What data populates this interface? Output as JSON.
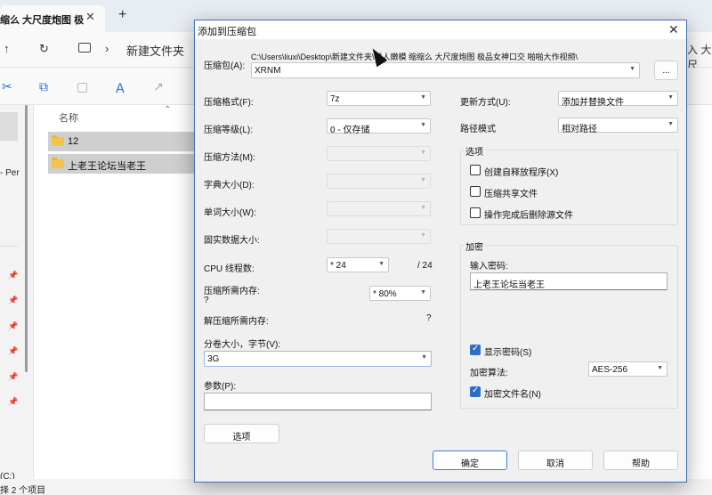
{
  "explorer": {
    "tab_title": "缩么 大尺度炮图 极",
    "tab_close": "✕",
    "new_tab": "+",
    "nav_up": "↑",
    "refresh": "↻",
    "breadcrumb_sep": "›",
    "breadcrumb": "新建文件夹",
    "address_tail": "入 大尺",
    "side_label": "- Per",
    "column_header": "名称",
    "sort_indicator": "⌃",
    "files": [
      {
        "name": "12"
      },
      {
        "name": "上老王论坛当老王"
      }
    ],
    "drive_label": "(C:)",
    "status_text": "择 2 个项目"
  },
  "dialog": {
    "title": "添加到压缩包",
    "close": "✕",
    "archive_label": "压缩包(A):",
    "archive_path": "C:\\Users\\liuxi\\Desktop\\新建文件夹\\诱人嫩模 缩缩么 大尺度炮图 极品女神口交 啪啪大作视频\\",
    "archive_name": "XRNM",
    "browse_label": "...",
    "left_fields": {
      "format_label": "压缩格式(F):",
      "format_value": "7z",
      "level_label": "压缩等级(L):",
      "level_value": "0 - 仅存储",
      "method_label": "压缩方法(M):",
      "dict_label": "字典大小(D):",
      "word_label": "单词大小(W):",
      "solid_label": "固实数据大小:",
      "cpu_label": "CPU 线程数:",
      "cpu_value": "* 24",
      "cpu_total": "/ 24",
      "mem_label": "压缩所需内存:",
      "mem_question": "?",
      "mem_value": "* 80%",
      "decomp_label": "解压缩所需内存:",
      "decomp_value": "?",
      "volume_label": "分卷大小，字节(V):",
      "volume_value": "3G",
      "params_label": "参数(P):",
      "params_value": "",
      "options_button": "选项"
    },
    "right_fields": {
      "update_label": "更新方式(U):",
      "update_value": "添加并替换文件",
      "path_label": "路径模式",
      "path_value": "相对路径",
      "options_group": "选项",
      "opt_sfx": "创建自释放程序(X)",
      "opt_shared": "压缩共享文件",
      "opt_delete": "操作完成后删除源文件",
      "encrypt_group": "加密",
      "password_label": "输入密码:",
      "password_value": "上老王论坛当老王",
      "show_password": "显示密码(S)",
      "method_label": "加密算法:",
      "method_value": "AES-256",
      "encrypt_names": "加密文件名(N)"
    },
    "buttons": {
      "ok": "确定",
      "cancel": "取消",
      "help": "帮助"
    }
  },
  "colors": {
    "accent": "#2d6ec9",
    "dialog_bg": "#f0f0f0",
    "folder": "#f3c44c"
  }
}
